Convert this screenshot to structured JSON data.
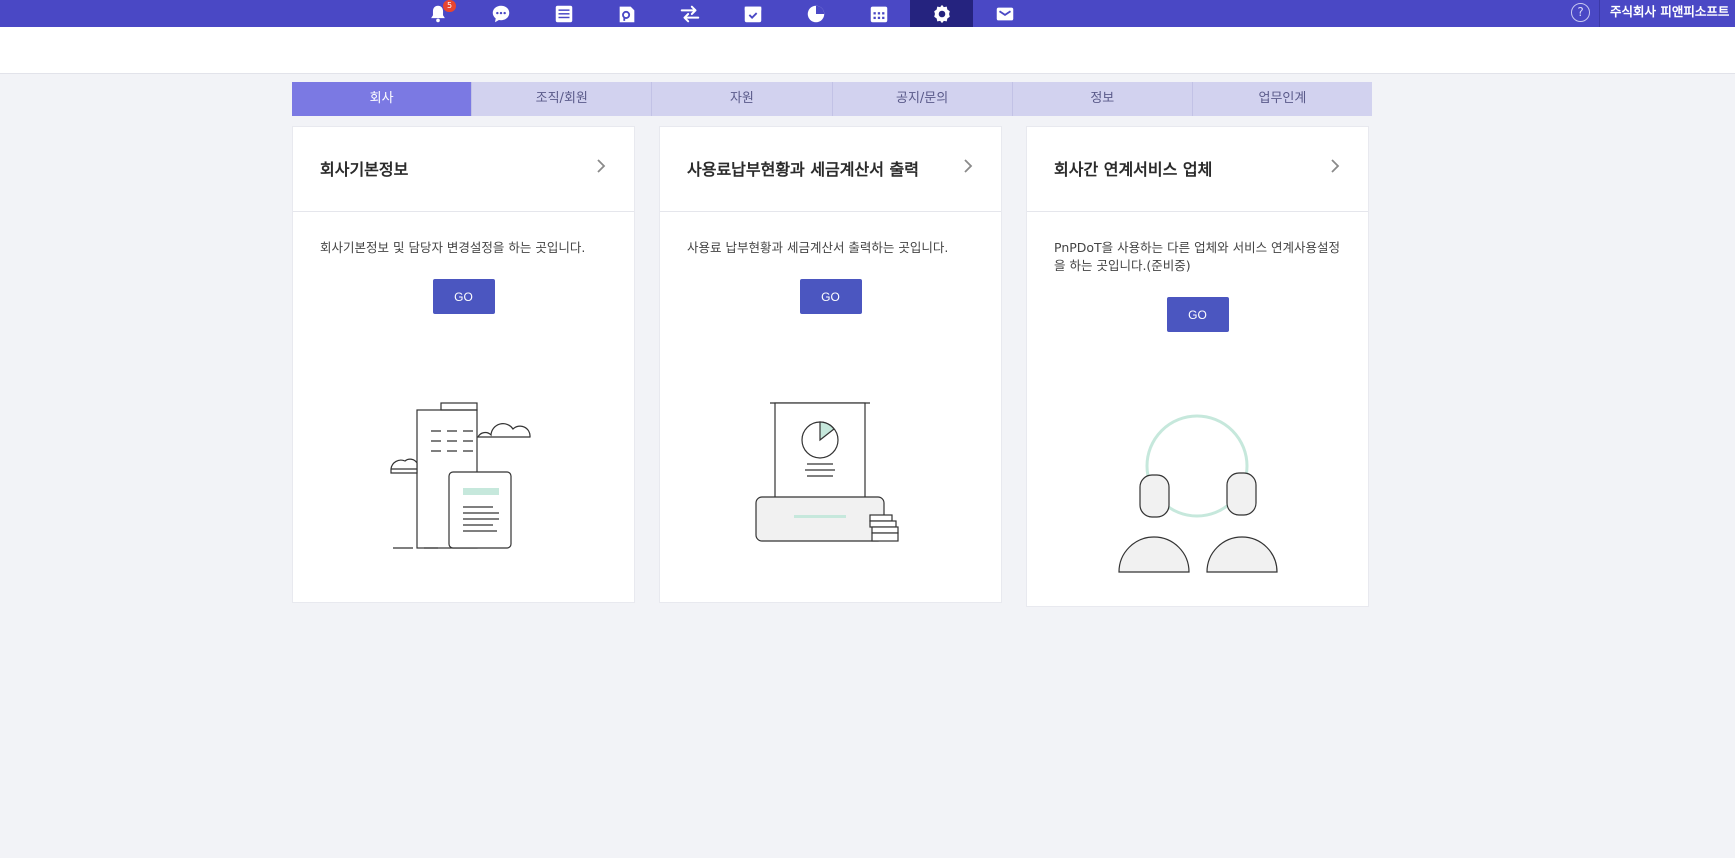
{
  "topbar": {
    "icons": [
      {
        "name": "bell-icon",
        "badge": "5"
      },
      {
        "name": "chat-icon"
      },
      {
        "name": "list-icon"
      },
      {
        "name": "document-search-icon"
      },
      {
        "name": "transfer-arrows-icon"
      },
      {
        "name": "calendar-check-icon"
      },
      {
        "name": "pie-chart-icon"
      },
      {
        "name": "calendar-icon"
      },
      {
        "name": "gear-icon",
        "active": true
      },
      {
        "name": "mail-icon"
      }
    ],
    "help": "?",
    "company_name": "주식회사 피앤피소프트",
    "colors": {
      "bar": "#4a48c5",
      "active": "#25237f",
      "badge": "#e8452f"
    }
  },
  "tabs": [
    "회사",
    "조직/회원",
    "자원",
    "공지/문의",
    "정보",
    "업무인계"
  ],
  "active_tab": "회사",
  "cards": [
    {
      "title": "회사기본정보",
      "description": "회사기본정보 및 담당자 변경설정을 하는 곳입니다.",
      "button": "GO"
    },
    {
      "title": "사용료납부현황과 세금계산서 출력",
      "description": "사용료 납부현황과 세금계산서 출력하는 곳입니다.",
      "button": "GO"
    },
    {
      "title": "회사간 연계서비스 업체",
      "description": "PnPDoT을 사용하는 다른 업체와 서비스 연계사용설정을 하는 곳입니다.(준비중)",
      "button": "GO"
    }
  ],
  "colors": {
    "accent": "#4b56c0",
    "tab_active": "#7b79e3",
    "tab": "#d2d2ef",
    "illustration_accent": "#c6e8dc"
  }
}
